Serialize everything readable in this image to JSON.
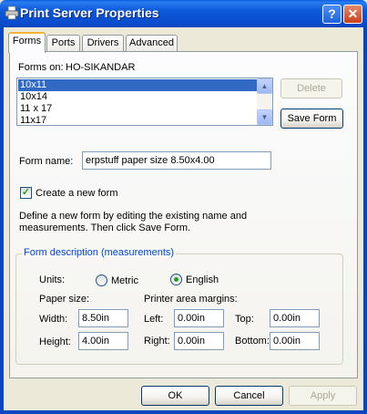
{
  "window": {
    "title": "Print Server Properties",
    "help_glyph": "?",
    "close_glyph": "✕"
  },
  "tabs": [
    {
      "label": "Forms",
      "active": true
    },
    {
      "label": "Ports",
      "active": false
    },
    {
      "label": "Drivers",
      "active": false
    },
    {
      "label": "Advanced",
      "active": false
    }
  ],
  "forms": {
    "forms_on_label": "Forms on:",
    "server_name": "HO-SIKANDAR",
    "list_items": [
      "10x11",
      "10x14",
      "11 x 17",
      "11x17"
    ],
    "selected_item": "10x11",
    "delete_label": "Delete",
    "save_form_label": "Save Form",
    "form_name_label": "Form name:",
    "form_name_value": "erpstuff paper size 8.50x4.00",
    "create_new_label": "Create a new form",
    "create_new_checked": true,
    "instructions": "Define a new form by editing the existing name and measurements.  Then click Save Form."
  },
  "description": {
    "group_title": "Form description (measurements)",
    "units_label": "Units:",
    "metric_label": "Metric",
    "english_label": "English",
    "selected_unit": "English",
    "paper_size_label": "Paper size:",
    "margins_label": "Printer area margins:",
    "width_label": "Width:",
    "width_value": "8.50in",
    "height_label": "Height:",
    "height_value": "4.00in",
    "left_label": "Left:",
    "left_value": "0.00in",
    "right_label": "Right:",
    "right_value": "0.00in",
    "top_label": "Top:",
    "top_value": "0.00in",
    "bottom_label": "Bottom:",
    "bottom_value": "0.00in"
  },
  "footer": {
    "ok_label": "OK",
    "cancel_label": "Cancel",
    "apply_label": "Apply"
  },
  "colors": {
    "titlebar": "#0a4fd0",
    "selection": "#316ac5",
    "group_title": "#0046d5",
    "tab_highlight": "#f8b239"
  }
}
